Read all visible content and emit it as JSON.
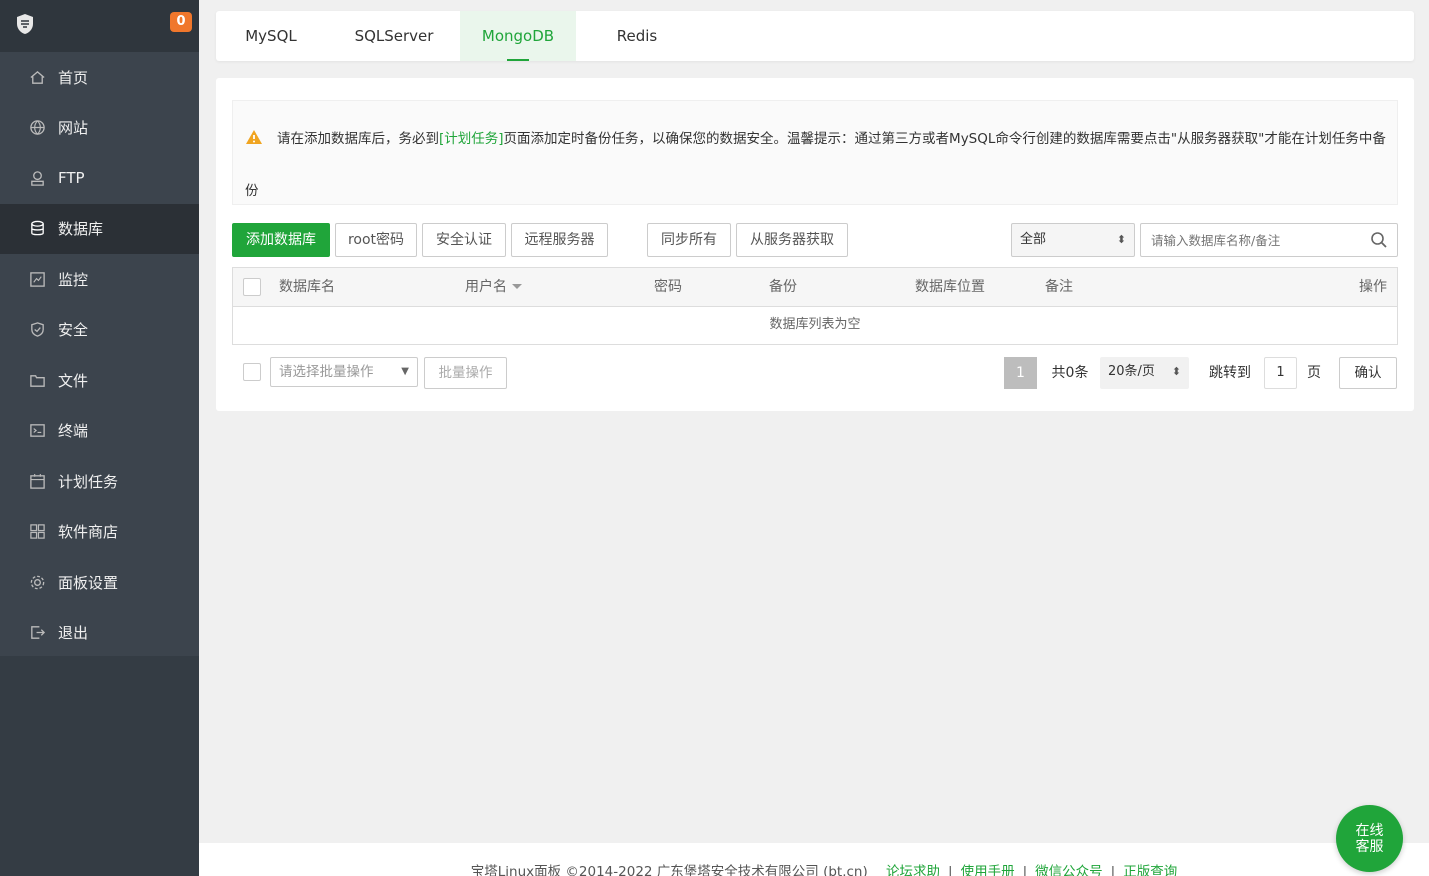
{
  "sidebar": {
    "badge": "0",
    "items": [
      {
        "label": "首页",
        "icon": "home-icon"
      },
      {
        "label": "网站",
        "icon": "globe-icon"
      },
      {
        "label": "FTP",
        "icon": "ftp-icon"
      },
      {
        "label": "数据库",
        "icon": "database-icon",
        "active": true
      },
      {
        "label": "监控",
        "icon": "monitor-icon"
      },
      {
        "label": "安全",
        "icon": "shield-icon"
      },
      {
        "label": "文件",
        "icon": "folder-icon"
      },
      {
        "label": "终端",
        "icon": "terminal-icon"
      },
      {
        "label": "计划任务",
        "icon": "calendar-icon"
      },
      {
        "label": "软件商店",
        "icon": "grid-icon"
      },
      {
        "label": "面板设置",
        "icon": "gear-icon"
      },
      {
        "label": "退出",
        "icon": "logout-icon"
      }
    ]
  },
  "tabs": {
    "mysql": "MySQL",
    "sqlserver": "SQLServer",
    "mongodb": "MongoDB",
    "redis": "Redis",
    "active": "MongoDB"
  },
  "notice": {
    "prefix": "请在添加数据库后，务必到",
    "link": "[计划任务]",
    "suffix": "页面添加定时备份任务，以确保您的数据安全。温馨提示：通过第三方或者MySQL命令行创建的数据库需要点击\"从服务器获取\"才能在计划任务中备份"
  },
  "toolbar": {
    "add_db": "添加数据库",
    "root_pwd": "root密码",
    "security_auth": "安全认证",
    "remote_server": "远程服务器",
    "sync_all": "同步所有",
    "fetch_from_server": "从服务器获取",
    "filter_selected": "全部",
    "search_placeholder": "请输入数据库名称/备注"
  },
  "table": {
    "columns": {
      "name": "数据库名",
      "user": "用户名",
      "password": "密码",
      "backup": "备份",
      "location": "数据库位置",
      "remark": "备注",
      "actions": "操作"
    },
    "empty": "数据库列表为空"
  },
  "bottom": {
    "batch_placeholder": "请选择批量操作",
    "batch_button": "批量操作",
    "current_page": "1",
    "total": "共0条",
    "page_size": "20条/页",
    "jump_to": "跳转到",
    "jump_value": "1",
    "page_unit": "页",
    "confirm": "确认"
  },
  "footer": {
    "copyright": "宝塔Linux面板 ©2014-2022 广东堡塔安全技术有限公司 (bt.cn)",
    "forum": "论坛求助",
    "manual": "使用手册",
    "wechat": "微信公众号",
    "genuine": "正版查询"
  },
  "service": {
    "line1": "在线",
    "line2": "客服"
  },
  "colors": {
    "brand_green": "#20a53a",
    "badge_orange": "#f0772c",
    "sidebar_bg": "#3c444d"
  }
}
